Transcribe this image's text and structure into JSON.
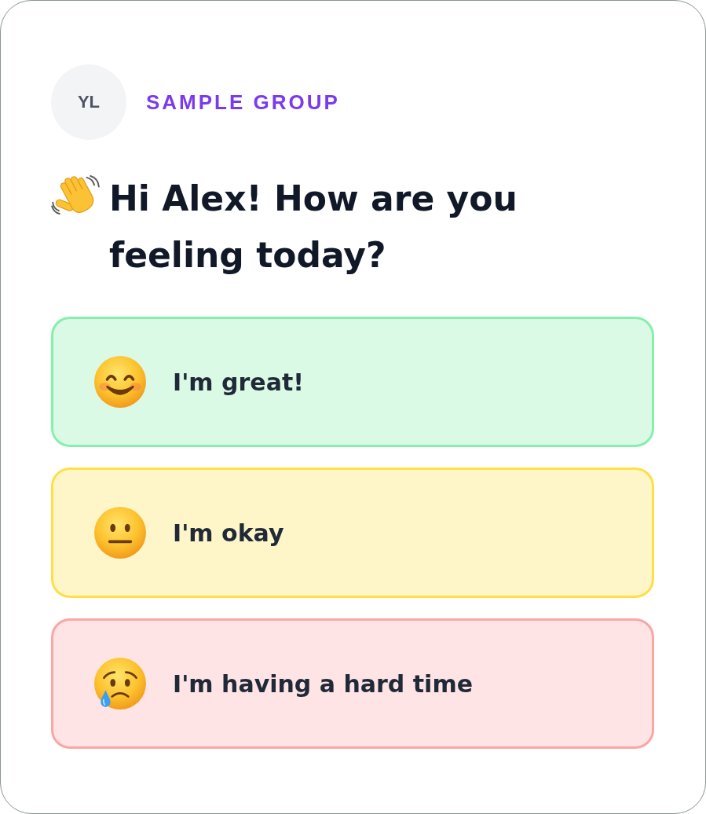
{
  "group": {
    "avatar_initials": "YL",
    "name": "SAMPLE GROUP"
  },
  "greeting": {
    "title": "Hi Alex! How are you feeling today?"
  },
  "options": [
    {
      "label": "I'm great!",
      "kind": "smile",
      "color": "#86efac"
    },
    {
      "label": "I'm okay",
      "kind": "neutral",
      "color": "#fde047"
    },
    {
      "label": "I'm having a hard time",
      "kind": "tear",
      "color": "#fca5a5"
    }
  ]
}
